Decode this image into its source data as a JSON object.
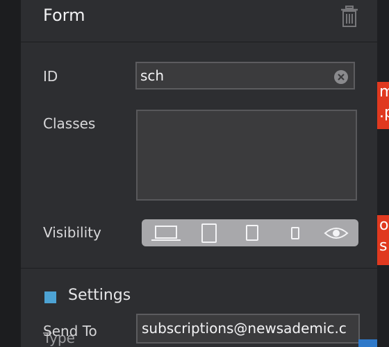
{
  "panel": {
    "title": "Form",
    "id_label": "ID",
    "id_value": "sch",
    "classes_label": "Classes",
    "classes_value": "",
    "visibility_label": "Visibility",
    "visibility_options": [
      "laptop-icon",
      "tablet-icon",
      "tablet-small-icon",
      "phone-icon",
      "eye-icon"
    ],
    "settings_label": "Settings",
    "send_to_label": "Send To",
    "send_to_value": "subscriptions@newsademic.c",
    "type_label": "Type"
  },
  "background_peek": {
    "text_a": "m\n.p",
    "text_b": "o\ns"
  },
  "colors": {
    "panel": "#2d2e31",
    "accent_square": "#4da3d4",
    "peek_red": "#e0391f"
  }
}
